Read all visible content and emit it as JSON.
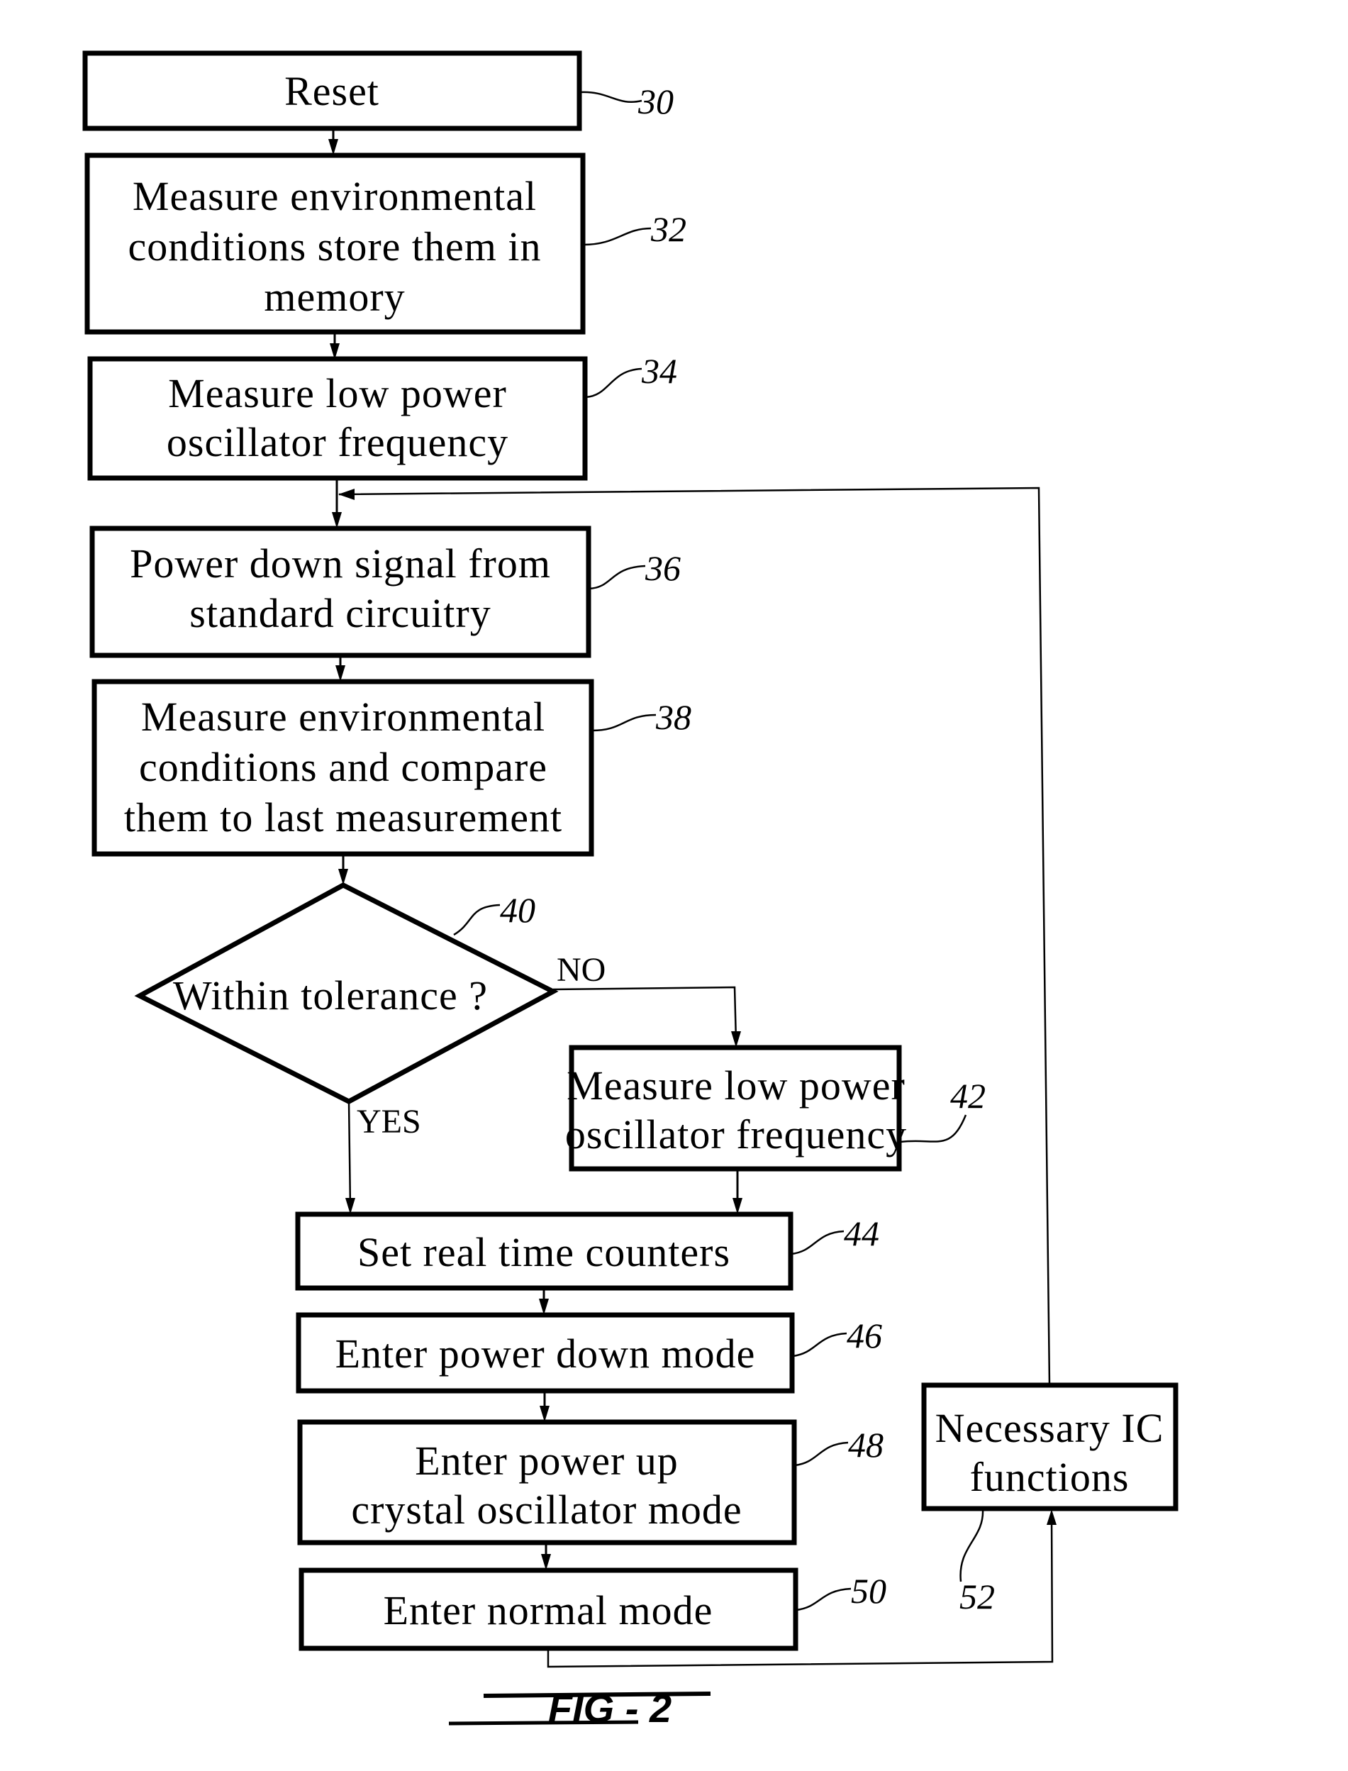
{
  "figure": {
    "label": "FIG - 2"
  },
  "steps": [
    {
      "id": "30",
      "lines": [
        "Reset"
      ]
    },
    {
      "id": "32",
      "lines": [
        "Measure environmental",
        "conditions store them in",
        "memory"
      ]
    },
    {
      "id": "34",
      "lines": [
        "Measure low power",
        "oscillator frequency"
      ]
    },
    {
      "id": "36",
      "lines": [
        "Power down signal from",
        "standard circuitry"
      ]
    },
    {
      "id": "38",
      "lines": [
        "Measure environmental",
        "conditions and compare",
        "them to last measurement"
      ]
    },
    {
      "id": "40",
      "lines": [
        "Within tolerance ?"
      ],
      "type": "decision",
      "yes_label": "YES",
      "no_label": "NO"
    },
    {
      "id": "42",
      "lines": [
        "Measure low power",
        "oscillator frequency"
      ]
    },
    {
      "id": "44",
      "lines": [
        "Set real time counters"
      ]
    },
    {
      "id": "46",
      "lines": [
        "Enter power down mode"
      ]
    },
    {
      "id": "48",
      "lines": [
        "Enter power up",
        "crystal oscillator mode"
      ]
    },
    {
      "id": "50",
      "lines": [
        "Enter normal mode"
      ]
    },
    {
      "id": "52",
      "lines": [
        "Necessary IC",
        "functions"
      ]
    }
  ],
  "colors": {
    "ink": "#000000",
    "paper": "#ffffff"
  }
}
